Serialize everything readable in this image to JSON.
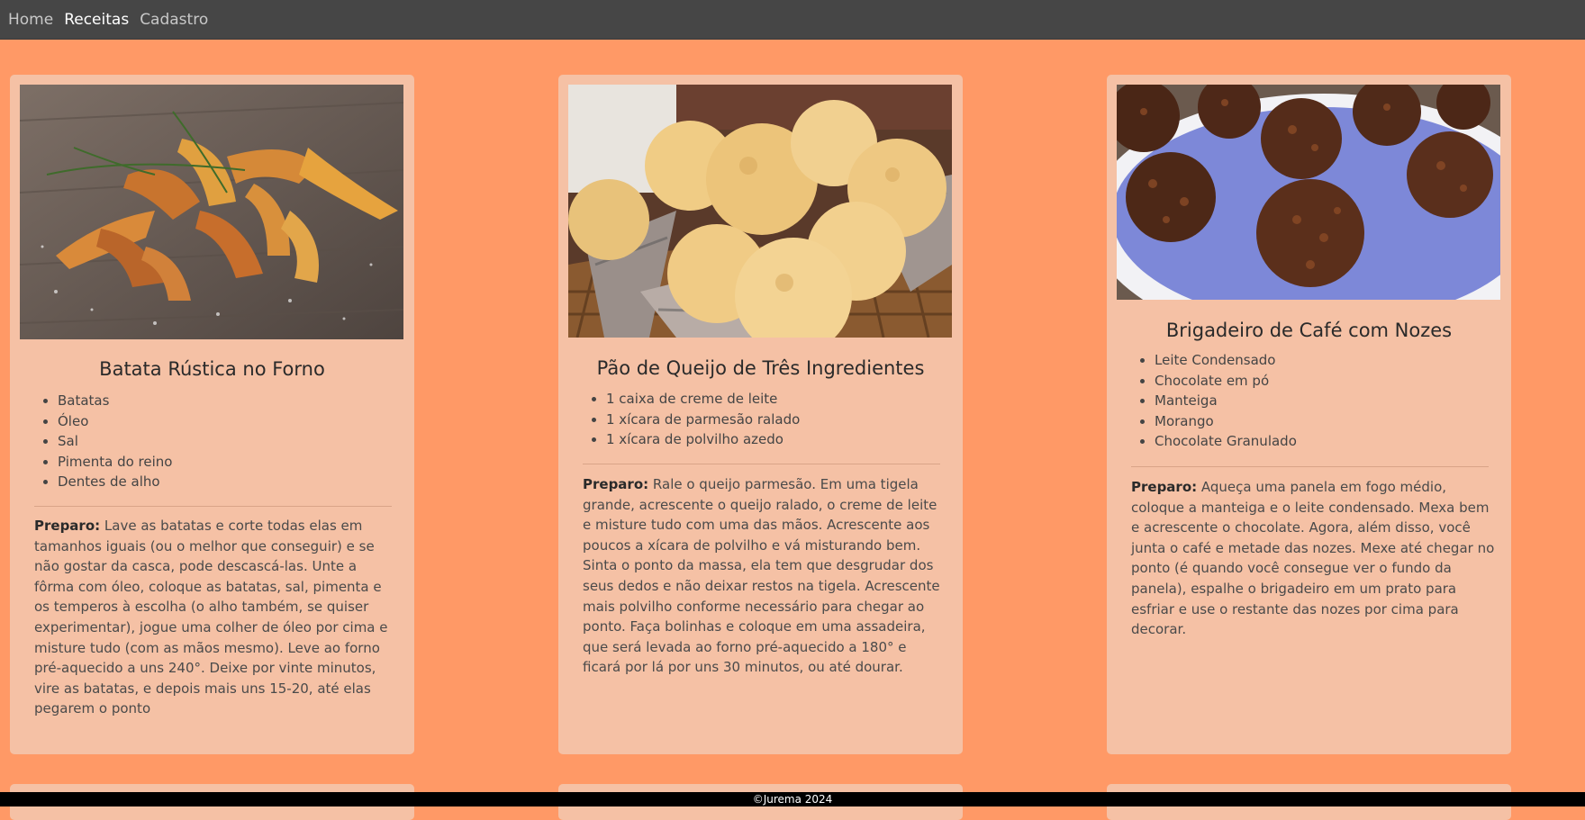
{
  "nav": {
    "items": [
      {
        "label": "Home"
      },
      {
        "label": "Receitas"
      },
      {
        "label": "Cadastro"
      }
    ]
  },
  "recipes": [
    {
      "title": "Batata Rústica no Forno",
      "image": "potato-wedges-photo",
      "ingredients": [
        "Batatas",
        "Óleo",
        "Sal",
        "Pimenta do reino",
        "Dentes de alho"
      ],
      "prep_label": "Preparo:",
      "prep_text": "Lave as batatas e corte todas elas em tamanhos iguais (ou o melhor que conseguir) e se não gostar da casca, pode descascá-las. Unte a fôrma com óleo, coloque as batatas, sal, pimenta e os temperos à escolha (o alho também, se quiser experimentar), jogue uma colher de óleo por cima e misture tudo (com as mãos mesmo). Leve ao forno pré-aquecido a uns 240°. Deixe por vinte minutos, vire as batatas, e depois mais uns 15-20, até elas pegarem o ponto"
    },
    {
      "title": "Pão de Queijo de Três Ingredientes",
      "image": "cheese-bread-basket-photo",
      "ingredients": [
        "1 caixa de creme de leite",
        "1 xícara de parmesão ralado",
        "1 xícara de polvilho azedo"
      ],
      "prep_label": "Preparo:",
      "prep_text": "Rale o queijo parmesão. Em uma tigela grande, acrescente o queijo ralado, o creme de leite e misture tudo com uma das mãos. Acrescente aos poucos a xícara de polvilho e vá misturando bem. Sinta o ponto da massa, ela tem que desgrudar dos seus dedos e não deixar restos na tigela. Acrescente mais polvilho conforme necessário para chegar ao ponto. Faça bolinhas e coloque em uma assadeira, que será levada ao forno pré-aquecido a 180° e ficará por lá por uns 30 minutos, ou até dourar."
    },
    {
      "title": "Brigadeiro de Café com Nozes",
      "image": "chocolate-brigadeiro-photo",
      "ingredients": [
        "Leite Condensado",
        "Chocolate em pó",
        "Manteiga",
        "Morango",
        "Chocolate Granulado"
      ],
      "prep_label": "Preparo:",
      "prep_text": "Aqueça uma panela em fogo médio, coloque a manteiga e o leite condensado. Mexa bem e acrescente o chocolate. Agora, além disso, você junta o café e metade das nozes. Mexe até chegar no ponto (é quando você consegue ver o fundo da panela), espalhe o brigadeiro em um prato para esfriar e use o restante das nozes por cima para decorar."
    }
  ],
  "footer": {
    "text": "©Jurema 2024"
  },
  "colors": {
    "background": "#ff9966",
    "card": "#f5c1a5",
    "navbar": "#464646",
    "footer": "#000000"
  }
}
